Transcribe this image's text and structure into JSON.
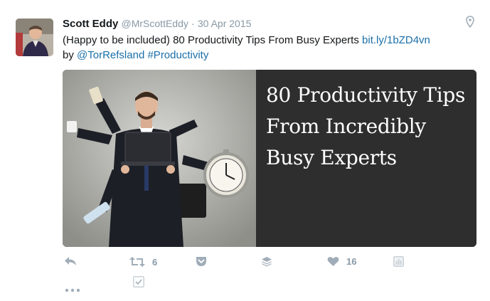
{
  "tweet": {
    "author_name": "Scott Eddy",
    "author_handle": "@MrScottEddy",
    "separator": "·",
    "date": "30 Apr 2015",
    "text_part1": "(Happy to be included) 80 Productivity Tips From Busy Experts ",
    "link": "bit.ly/1bZD4vn",
    "text_by": "by ",
    "mention": "@TorRefsland",
    "text_space": " ",
    "hashtag": "#Productivity"
  },
  "media": {
    "title_lines": [
      "80 Productivity Tips",
      "From Incredibly",
      "Busy Experts"
    ]
  },
  "actions": {
    "retweet_count": "6",
    "like_count": "16"
  },
  "colors": {
    "link": "#1b6fa8",
    "icon_gray": "#a0adb8",
    "panel_bg": "#2e2e2e"
  }
}
